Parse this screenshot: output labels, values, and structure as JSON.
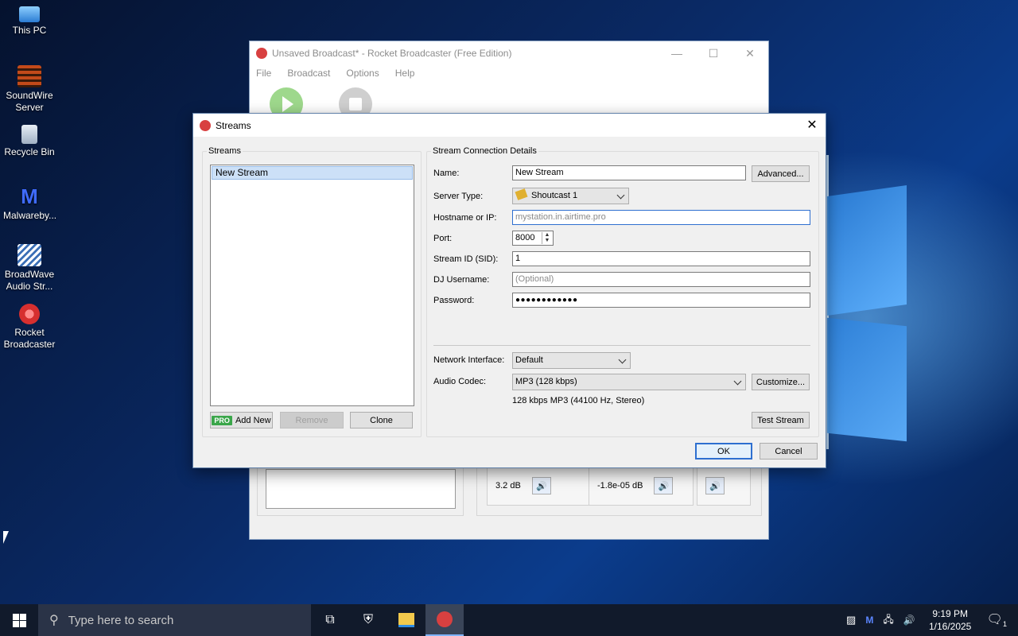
{
  "desktop": {
    "icons": [
      {
        "label": "This PC"
      },
      {
        "label": "SoundWire Server"
      },
      {
        "label": "Recycle Bin"
      },
      {
        "label": "Malwareby..."
      },
      {
        "label": "BroadWave Audio Str..."
      },
      {
        "label": "Rocket Broadcaster"
      }
    ]
  },
  "main_window": {
    "title": "Unsaved Broadcast* - Rocket Broadcaster (Free Edition)",
    "menu": [
      "File",
      "Broadcast",
      "Options",
      "Help"
    ],
    "meters": [
      {
        "value": "3.2 dB"
      },
      {
        "value": "-1.8e-05 dB"
      }
    ]
  },
  "dialog": {
    "title": "Streams",
    "streams_group_label": "Streams",
    "streams": [
      "New Stream"
    ],
    "add_new_badge": "PRO",
    "add_new_label": "Add New",
    "remove_label": "Remove",
    "clone_label": "Clone",
    "details_group_label": "Stream Connection Details",
    "fields": {
      "name_label": "Name:",
      "name_value": "New Stream",
      "advanced_label": "Advanced...",
      "server_type_label": "Server Type:",
      "server_type_value": "Shoutcast 1",
      "hostname_label": "Hostname or IP:",
      "hostname_placeholder": "mystation.in.airtime.pro",
      "port_label": "Port:",
      "port_value": "8000",
      "sid_label": "Stream ID (SID):",
      "sid_value": "1",
      "dj_label": "DJ Username:",
      "dj_placeholder": "(Optional)",
      "password_label": "Password:",
      "password_value": "●●●●●●●●●●●●",
      "network_label": "Network Interface:",
      "network_value": "Default",
      "codec_label": "Audio Codec:",
      "codec_value": "MP3 (128 kbps)",
      "customize_label": "Customize...",
      "codec_summary": "128 kbps MP3 (44100 Hz, Stereo)",
      "test_stream_label": "Test Stream"
    },
    "ok_label": "OK",
    "cancel_label": "Cancel"
  },
  "taskbar": {
    "search_placeholder": "Type here to search",
    "time": "9:19 PM",
    "date": "1/16/2025",
    "notification_count": "1"
  },
  "colors": {
    "accent": "#2e6fd0",
    "taskbar": "#111a2b",
    "pro_badge": "#3aa64a"
  }
}
